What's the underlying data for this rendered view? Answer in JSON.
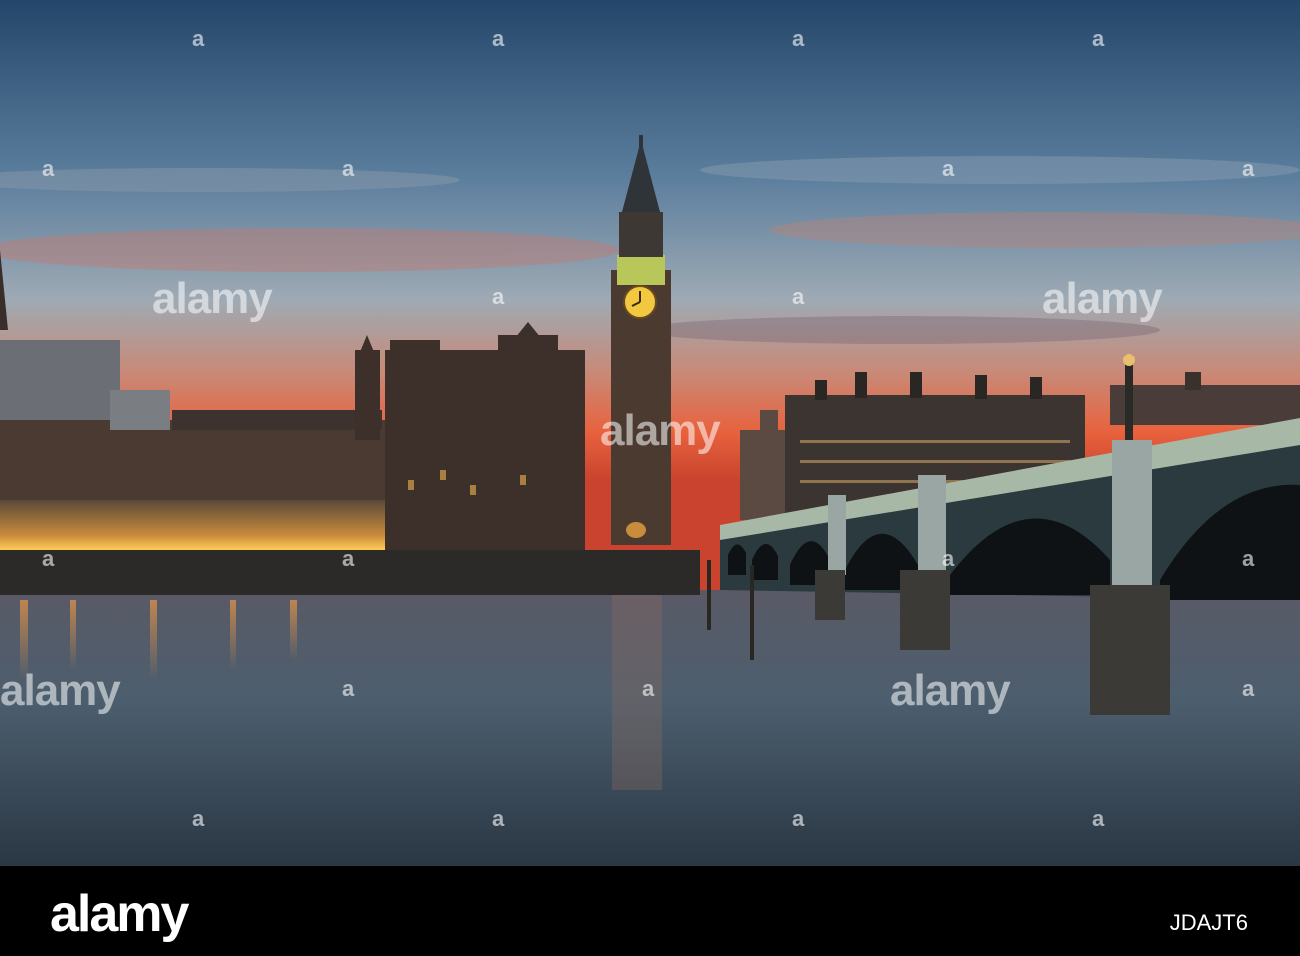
{
  "watermark": {
    "text": "alamy",
    "small_mark": "a"
  },
  "footer": {
    "logo": "alamy",
    "image_code": "JDAJT6"
  },
  "colors": {
    "sky_top": "#2f4f6e",
    "sky_mid": "#8aa3b8",
    "sunset": "#e0603d",
    "building_light": "#f2b347",
    "water": "#3a4a58",
    "footer_bg": "#000000"
  }
}
